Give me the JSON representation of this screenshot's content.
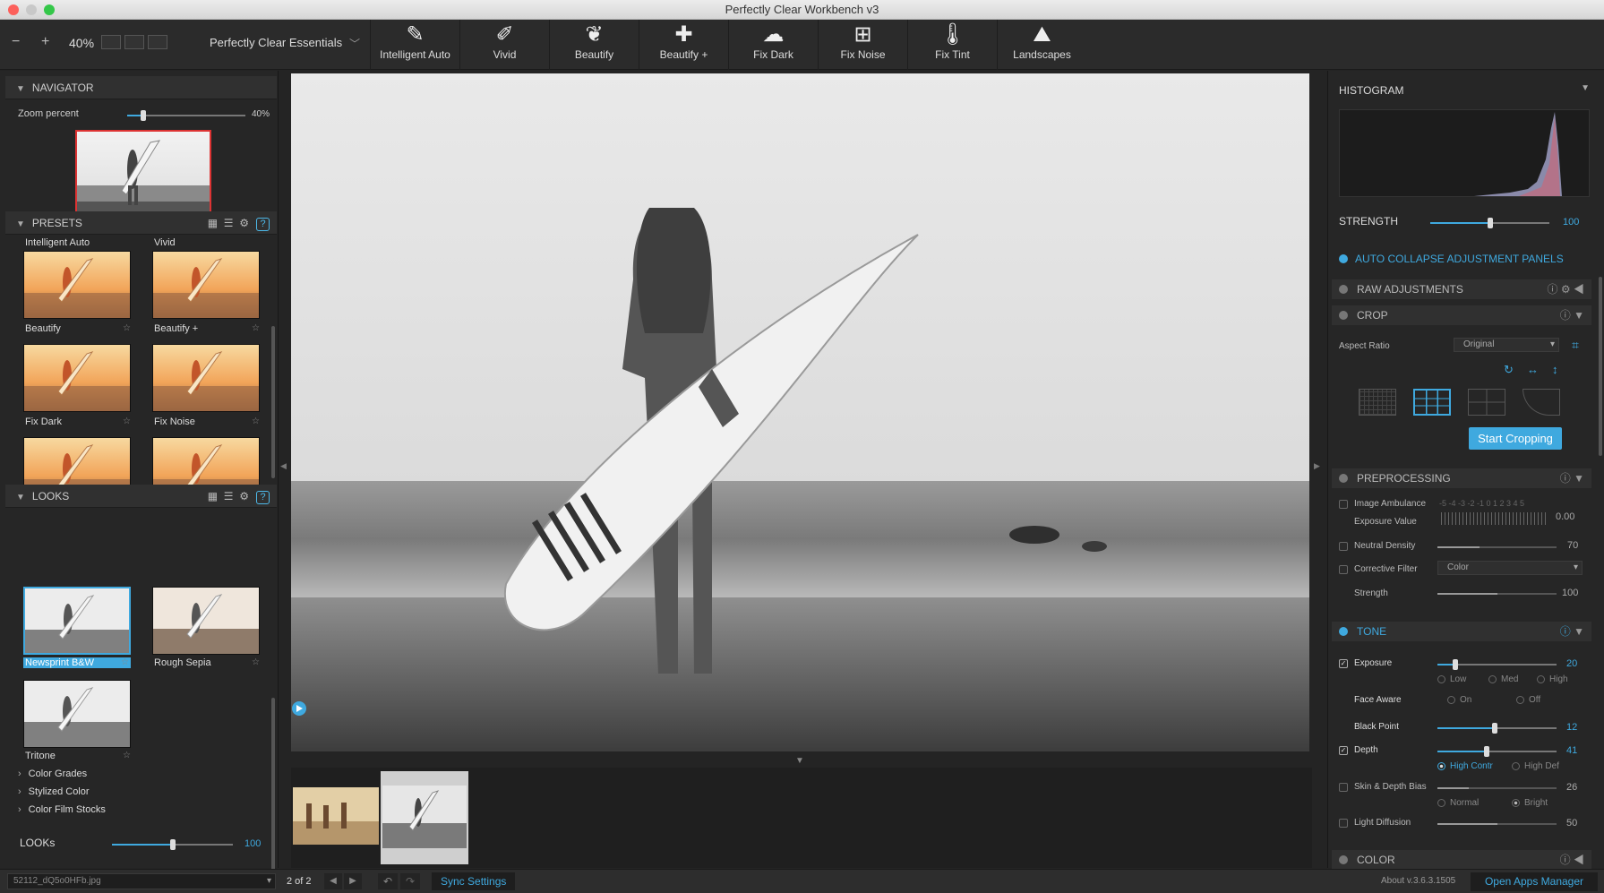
{
  "window": {
    "title": "Perfectly Clear Workbench v3"
  },
  "toolbar": {
    "zoom_out": "−",
    "zoom_in": "+",
    "zoom": "40%",
    "preset_set": "Perfectly Clear Essentials",
    "buttons": [
      {
        "label": "Intelligent Auto",
        "icon": "wand-hd-icon",
        "glyph": "✎"
      },
      {
        "label": "Vivid",
        "icon": "brush-icon",
        "glyph": "✐"
      },
      {
        "label": "Beautify",
        "icon": "face-icon",
        "glyph": "❦"
      },
      {
        "label": "Beautify +",
        "icon": "face-plus-icon",
        "glyph": "✚"
      },
      {
        "label": "Fix Dark",
        "icon": "cloud-icon",
        "glyph": "☁"
      },
      {
        "label": "Fix Noise",
        "icon": "noise-icon",
        "glyph": "⊞"
      },
      {
        "label": "Fix Tint",
        "icon": "thermometer-icon",
        "glyph": "🌡"
      },
      {
        "label": "Landscapes",
        "icon": "landscape-icon",
        "glyph": "⛰"
      }
    ]
  },
  "navigator": {
    "title": "NAVIGATOR",
    "zoom_label": "Zoom percent",
    "zoom_value": "40%",
    "zoom_fraction": 0.14
  },
  "presets": {
    "title": "PRESETS",
    "help": "?",
    "partial_labels": [
      "Intelligent Auto",
      "Vivid"
    ],
    "items": [
      {
        "label": "Beautify"
      },
      {
        "label": "Beautify +"
      },
      {
        "label": "Fix Dark"
      },
      {
        "label": "Fix Noise"
      },
      {
        "label": ""
      },
      {
        "label": ""
      }
    ]
  },
  "looks": {
    "title": "LOOKS",
    "help": "?",
    "items": [
      {
        "label": "Newsprint B&W",
        "selected": true
      },
      {
        "label": "Rough Sepia"
      },
      {
        "label": "Tritone"
      }
    ],
    "groups": [
      "Color Grades",
      "Stylized Color",
      "Color Film Stocks"
    ],
    "strength_label": "LOOKs",
    "strength_value": "100",
    "strength_fraction": 0.5
  },
  "right": {
    "histogram_title": "HISTOGRAM",
    "strength_label": "STRENGTH",
    "strength_value": "100",
    "strength_fraction": 0.5,
    "auto_collapse": "AUTO COLLAPSE ADJUSTMENT PANELS",
    "raw": "RAW ADJUSTMENTS",
    "crop": {
      "title": "CROP",
      "aspect_label": "Aspect Ratio",
      "aspect_value": "Original",
      "start": "Start Cropping"
    },
    "preprocessing": {
      "title": "PREPROCESSING",
      "ambulance": "Image Ambulance",
      "ev_scale": "-5 -4 -3 -2 -1 0 1 2 3 4 5",
      "exposure_value": "Exposure Value",
      "ev": "0.00",
      "neutral_density": "Neutral Density",
      "nd_value": "70",
      "nd_fraction": 0.35,
      "corrective_filter": "Corrective Filter",
      "filter_value": "Color",
      "strength": "Strength",
      "strength_value": "100",
      "strength_fraction": 0.5
    },
    "tone": {
      "title": "TONE",
      "exposure": "Exposure",
      "exposure_value": "20",
      "exposure_fraction": 0.15,
      "levels": [
        "Low",
        "Med",
        "High"
      ],
      "face_aware": "Face Aware",
      "face_opts": [
        "On",
        "Off"
      ],
      "black_point": "Black Point",
      "black_point_value": "12",
      "black_point_fraction": 0.48,
      "depth": "Depth",
      "depth_value": "41",
      "depth_fraction": 0.41,
      "depth_opts": [
        "High Contr",
        "High Def"
      ],
      "skin_depth": "Skin & Depth Bias",
      "skin_value": "26",
      "skin_fraction": 0.26,
      "bias_opts": [
        "Normal",
        "Bright"
      ],
      "light_diffusion": "Light Diffusion",
      "light_value": "50",
      "light_fraction": 0.5
    },
    "color": "COLOR"
  },
  "status": {
    "file": "52112_dQ5o0HFb.jpg",
    "count": "2 of 2",
    "sync": "Sync Settings",
    "about": "About v.3.6.3.1505",
    "apps": "Open Apps Manager"
  }
}
